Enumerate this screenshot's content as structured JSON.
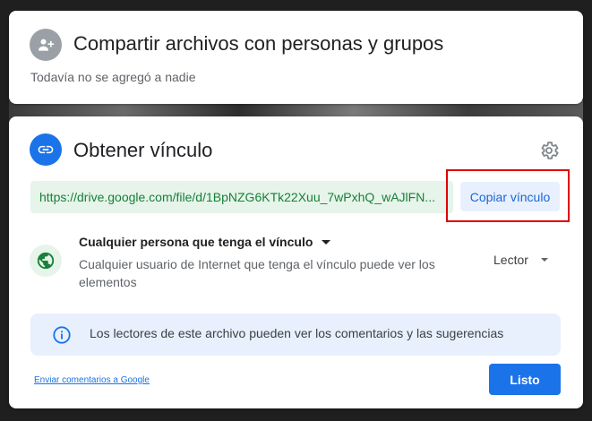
{
  "share": {
    "title": "Compartir archivos con personas y grupos",
    "subtitle": "Todavía no se agregó a nadie",
    "icon": "add-person-icon"
  },
  "link": {
    "title": "Obtener vínculo",
    "icon": "link-icon",
    "settings_icon": "gear-icon",
    "url": "https://drive.google.com/file/d/1BpNZG6KTk22Xuu_7wPxhQ_wAJlFN...",
    "copy_label": "Copiar vínculo",
    "access": {
      "title": "Cualquier persona que tenga el vínculo",
      "description": "Cualquier usuario de Internet que tenga el vínculo puede ver los elementos",
      "icon": "globe-icon"
    },
    "role": "Lector",
    "info_text": "Los lectores de este archivo pueden ver los comentarios y las sugerencias",
    "feedback_label": "Enviar comentarios a Google",
    "done_label": "Listo"
  },
  "colors": {
    "accent": "#1a73e8",
    "url_text": "#188038",
    "url_bg": "#e6f4ea",
    "highlight": "#e00000"
  }
}
